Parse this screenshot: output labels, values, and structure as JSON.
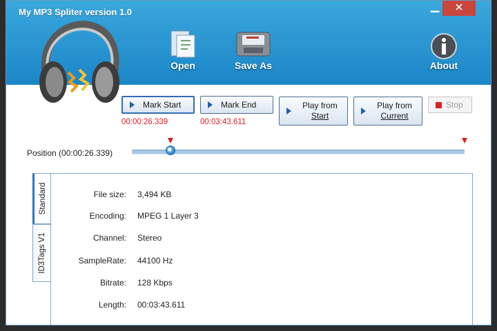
{
  "window": {
    "title": "My MP3 Spliter  version 1.0",
    "minimize": "▁",
    "close": "✕"
  },
  "toolbar": {
    "open": "Open",
    "save_as": "Save As",
    "about": "About"
  },
  "buttons": {
    "mark_start": "Mark Start",
    "mark_end": "Mark End",
    "play_from_start_l1": "Play from",
    "play_from_start_l2": "Start",
    "play_from_current_l1": "Play from",
    "play_from_current_l2": "Current",
    "stop": "Stop"
  },
  "times": {
    "start": "00:00:26.339",
    "end": "00:03:43.611"
  },
  "position": {
    "label": "Position (00:00:26.339)",
    "fraction": 0.117
  },
  "tabs": {
    "standard": "Standard",
    "id3": "ID3Tags V1"
  },
  "info": [
    {
      "key": "File size:",
      "value": "3,494 KB"
    },
    {
      "key": "Encoding:",
      "value": "MPEG 1 Layer 3"
    },
    {
      "key": "Channel:",
      "value": "Stereo"
    },
    {
      "key": "SampleRate:",
      "value": "44100 Hz"
    },
    {
      "key": "Bitrate:",
      "value": "128 Kbps"
    },
    {
      "key": "Length:",
      "value": "00:03:43.611"
    }
  ],
  "colors": {
    "header": "#1f8ccb",
    "time_text": "#e21f1f",
    "close_button": "#c9463d"
  }
}
